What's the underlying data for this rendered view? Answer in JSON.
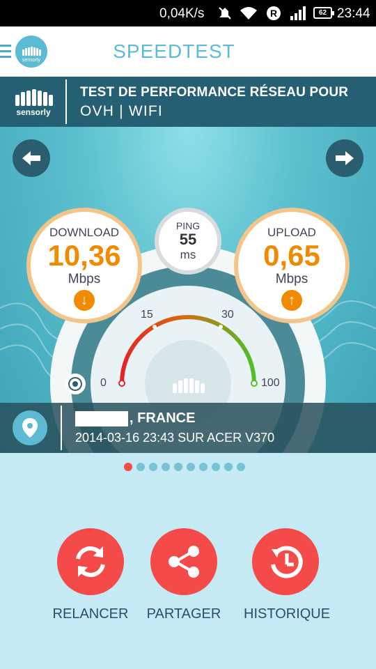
{
  "status_bar": {
    "net_speed": "0,04K/s",
    "battery": "62",
    "time": "23:44",
    "icons": [
      "mute-icon",
      "wifi-icon",
      "roaming-r-icon",
      "signal-icon",
      "battery-icon"
    ]
  },
  "app_bar": {
    "title": "SPEEDTEST",
    "logo_text": "sensorly"
  },
  "header": {
    "brand": "sensorly",
    "line1": "TEST DE PERFORMANCE RÉSEAU POUR",
    "line2": "OVH | WIFI"
  },
  "result": {
    "download": {
      "label": "DOWNLOAD",
      "value": "10,36",
      "unit": "Mbps"
    },
    "upload": {
      "label": "UPLOAD",
      "value": "0,65",
      "unit": "Mbps"
    },
    "ping": {
      "label": "PING",
      "value": "55",
      "unit": "ms"
    },
    "gauge_ticks": {
      "t0": "0",
      "t15": "15",
      "t30": "30",
      "t100": "100"
    }
  },
  "location": {
    "city": ", FRANCE",
    "subtitle": "2014-03-16 23:43 SUR ACER V370"
  },
  "pager": {
    "count": 10,
    "active": 0
  },
  "actions": {
    "restart": "RELANCER",
    "share": "PARTAGER",
    "history": "HISTORIQUE"
  },
  "colors": {
    "accent": "#5cbad3",
    "header_bg": "#255f73",
    "value_orange": "#f08a00",
    "action_red": "#f44a4a",
    "page_bg": "#c6eaf3"
  }
}
